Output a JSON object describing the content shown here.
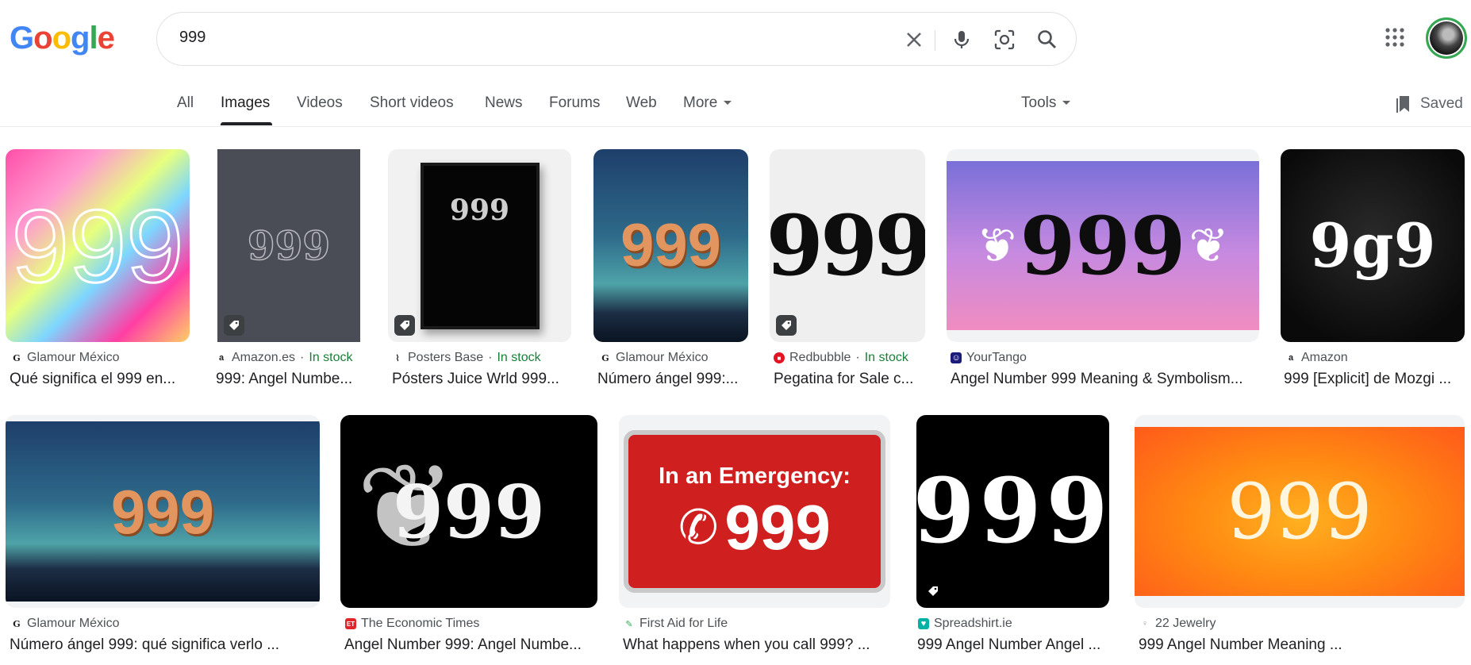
{
  "logo": [
    "G",
    "o",
    "o",
    "g",
    "l",
    "e"
  ],
  "logo_colors": [
    "#4285f4",
    "#ea4335",
    "#fbbc05",
    "#4285f4",
    "#34a853",
    "#ea4335"
  ],
  "search": {
    "query": "999"
  },
  "tabs": [
    "All",
    "Images",
    "Videos",
    "Short videos",
    "News",
    "Forums",
    "Web",
    "More",
    "Tools"
  ],
  "saved_label": "Saved",
  "results": [
    {
      "source": "Glamour México",
      "stock": "",
      "title": "Qué significa el 999 en..."
    },
    {
      "source": "Amazon.es",
      "stock": "In stock",
      "title": "999: Angel Numbe..."
    },
    {
      "source": "Posters Base",
      "stock": "In stock",
      "title": "Pósters Juice Wrld 999..."
    },
    {
      "source": "Glamour México",
      "stock": "",
      "title": "Número ángel 999:..."
    },
    {
      "source": "Redbubble",
      "stock": "In stock",
      "title": "Pegatina for Sale c..."
    },
    {
      "source": "YourTango",
      "stock": "",
      "title": "Angel Number 999 Meaning & Symbolism..."
    },
    {
      "source": "Amazon",
      "stock": "",
      "title": "999 [Explicit] de Mozgi ..."
    },
    {
      "source": "Glamour México",
      "stock": "",
      "title": "Número ángel 999: qué significa verlo ..."
    },
    {
      "source": "The Economic Times",
      "stock": "",
      "title": "Angel Number 999: Angel Numbe..."
    },
    {
      "source": "First Aid for Life",
      "stock": "",
      "title": "What happens when you call 999? ..."
    },
    {
      "source": "Spreadshirt.ie",
      "stock": "",
      "title": "999 Angel Number Angel ..."
    },
    {
      "source": "22 Jewelry",
      "stock": "",
      "title": "999 Angel Number Meaning ..."
    }
  ],
  "thumb_text": {
    "main": "999",
    "gothic": "9g9",
    "emergency_heading": "In an Emergency:"
  },
  "stock_separator": "·"
}
